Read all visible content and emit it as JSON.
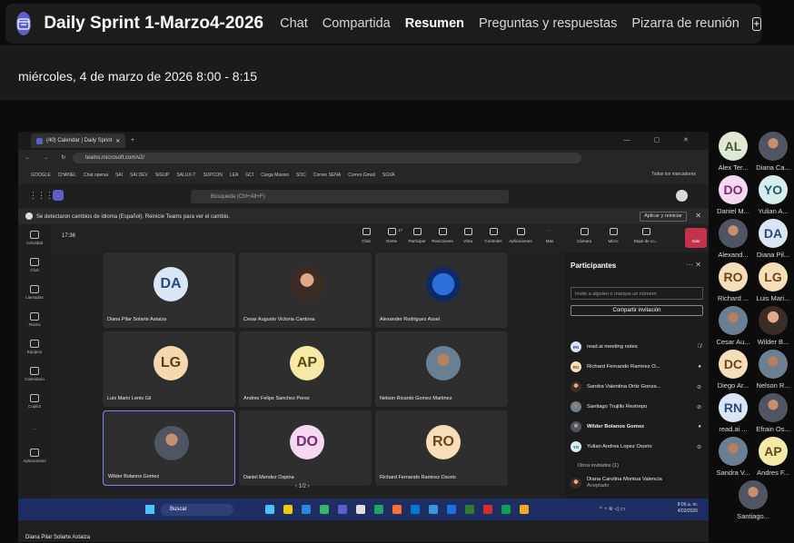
{
  "meeting": {
    "title": "Daily Sprint 1-Marzo4-2026",
    "tabs": [
      "Chat",
      "Compartida",
      "Resumen",
      "Preguntas y respuestas",
      "Pizarra de reunión"
    ],
    "active_tab": "Resumen",
    "date_time": "miércoles, 4 de marzo de 2026 8:00 - 8:15"
  },
  "colors": {
    "accent": "#5b5fc7",
    "tile_avatar_bg": "#f4d9b0",
    "tile_avatar_fg": "#5b3b19",
    "leave": "#c4314b"
  },
  "shared_screen": {
    "browser_tab": "(40) Calendar | Daily Sprint",
    "url": "teams.microsoft.com/v2/",
    "bookmarks": [
      "GOOGLE",
      "CHANEL",
      "Chat openai",
      "SAI",
      "SAI DEV",
      "SIGUP",
      "SALUX-T",
      "SUPCON",
      "LEA",
      "GCI",
      "Carga Masivo",
      "SOC",
      "Correo SENA",
      "Correo Gmail",
      "SGVA"
    ],
    "bookmarks_all": "Todos los marcadores",
    "search_placeholder": "Búsqueda (Ctrl+Alt+F)",
    "language_notice": "Se detectaron cambios de idioma (Español). Reinicie Teams para ver el cambio.",
    "language_button": "Aplicar y reiniciar",
    "rail": [
      "Actividad",
      "Chat",
      "Llamadas",
      "Teams",
      "Equipos",
      "Calendario",
      "Copilot",
      "Aplicaciones"
    ],
    "call_timer": "17:36",
    "call_buttons": [
      "Chat",
      "Gente",
      "Participar",
      "Reacciones",
      "Vista",
      "Controles",
      "Aplicaciones",
      "Más",
      "Cámara",
      "Micro",
      "Dejar de co...",
      "Salir"
    ],
    "participants_count": "17",
    "tiles": [
      {
        "initials": "DA",
        "name": "Diana Pilar Solarte Astaiza",
        "photo": false
      },
      {
        "initials": "",
        "name": "Cesar Augusto Victoria Cardona",
        "photo": true
      },
      {
        "initials": "",
        "name": "Alexander Rodriguez Assel",
        "photo": true
      },
      {
        "initials": "LG",
        "name": "Luis Mario Lenis Gil",
        "photo": false
      },
      {
        "initials": "AP",
        "name": "Andres Felipe Sanchez Perez",
        "photo": false
      },
      {
        "initials": "",
        "name": "Nelson Ricardo Gomez Martinez",
        "photo": true
      },
      {
        "initials": "",
        "name": "Wilder Bolanos Gomez",
        "photo": true
      },
      {
        "initials": "DO",
        "name": "Daniel Mendez Ospina",
        "photo": false
      },
      {
        "initials": "RO",
        "name": "Richard Fernando Ramirez Osorio",
        "photo": false
      }
    ],
    "pager": "1/2",
    "panel": {
      "title": "Participantes",
      "invite_placeholder": "Invite a alguien o marque un número",
      "share_button": "Compartir invitación",
      "people": [
        {
          "initials": "RN",
          "name": "read.ai meeting notes"
        },
        {
          "initials": "RO",
          "name": "Richard Fernando Ramirez O..."
        },
        {
          "initials": "",
          "name": "Sandra Valentina Ortiz Gonza..."
        },
        {
          "initials": "",
          "name": "Santiago Trujillo Restrepo"
        },
        {
          "initials": "",
          "name": "Wilder Bolanos Gomez"
        },
        {
          "initials": "YO",
          "name": "Yulian Andres Lopez Osorio"
        }
      ],
      "others_header": "Otros invitados (1)",
      "other_name": "Diana Carolina Montua Valencia",
      "other_status": "Aceptado"
    },
    "taskbar_search": "Buscar",
    "clock_time": "8:06 a. m.",
    "clock_date": "4/03/2026",
    "sharer_name": "Diana Pilar Solarte Astaiza"
  },
  "gallery": [
    {
      "initials": "AL",
      "label": "Alex Ter...",
      "bg": "#dfe8d4",
      "fg": "#3e5a2a"
    },
    {
      "initials": "",
      "label": "Diana Ca...",
      "bg": "",
      "fg": ""
    },
    {
      "initials": "DO",
      "label": "Daniel M...",
      "bg": "#f4d9f0",
      "fg": "#7a2a6e"
    },
    {
      "initials": "YO",
      "label": "Yulian A...",
      "bg": "#d6eef0",
      "fg": "#1f5a60"
    },
    {
      "initials": "",
      "label": "Alexand...",
      "bg": "",
      "fg": ""
    },
    {
      "initials": "DA",
      "label": "Diana Pil...",
      "bg": "#dbe6f5",
      "fg": "#264a7e"
    },
    {
      "initials": "RO",
      "label": "Richard ...",
      "bg": "#f6dfb8",
      "fg": "#6b431b"
    },
    {
      "initials": "LG",
      "label": "Luis Mari...",
      "bg": "#f6dfb8",
      "fg": "#6b431b"
    },
    {
      "initials": "",
      "label": "Cesar Au...",
      "bg": "",
      "fg": ""
    },
    {
      "initials": "",
      "label": "Wilder B...",
      "bg": "",
      "fg": ""
    },
    {
      "initials": "DC",
      "label": "Diego Ar...",
      "bg": "#f6dfb8",
      "fg": "#6b431b"
    },
    {
      "initials": "",
      "label": "Nelson R...",
      "bg": "",
      "fg": ""
    },
    {
      "initials": "RN",
      "label": "read.ai ...",
      "bg": "#dbe6f5",
      "fg": "#264a7e"
    },
    {
      "initials": "",
      "label": "Efrain Os...",
      "bg": "",
      "fg": ""
    },
    {
      "initials": "",
      "label": "Sandra V...",
      "bg": "",
      "fg": ""
    },
    {
      "initials": "AP",
      "label": "Andres F...",
      "bg": "#f6e9a8",
      "fg": "#5a4a10"
    },
    {
      "initials": "",
      "label": "Santiago...",
      "bg": "",
      "fg": ""
    }
  ]
}
